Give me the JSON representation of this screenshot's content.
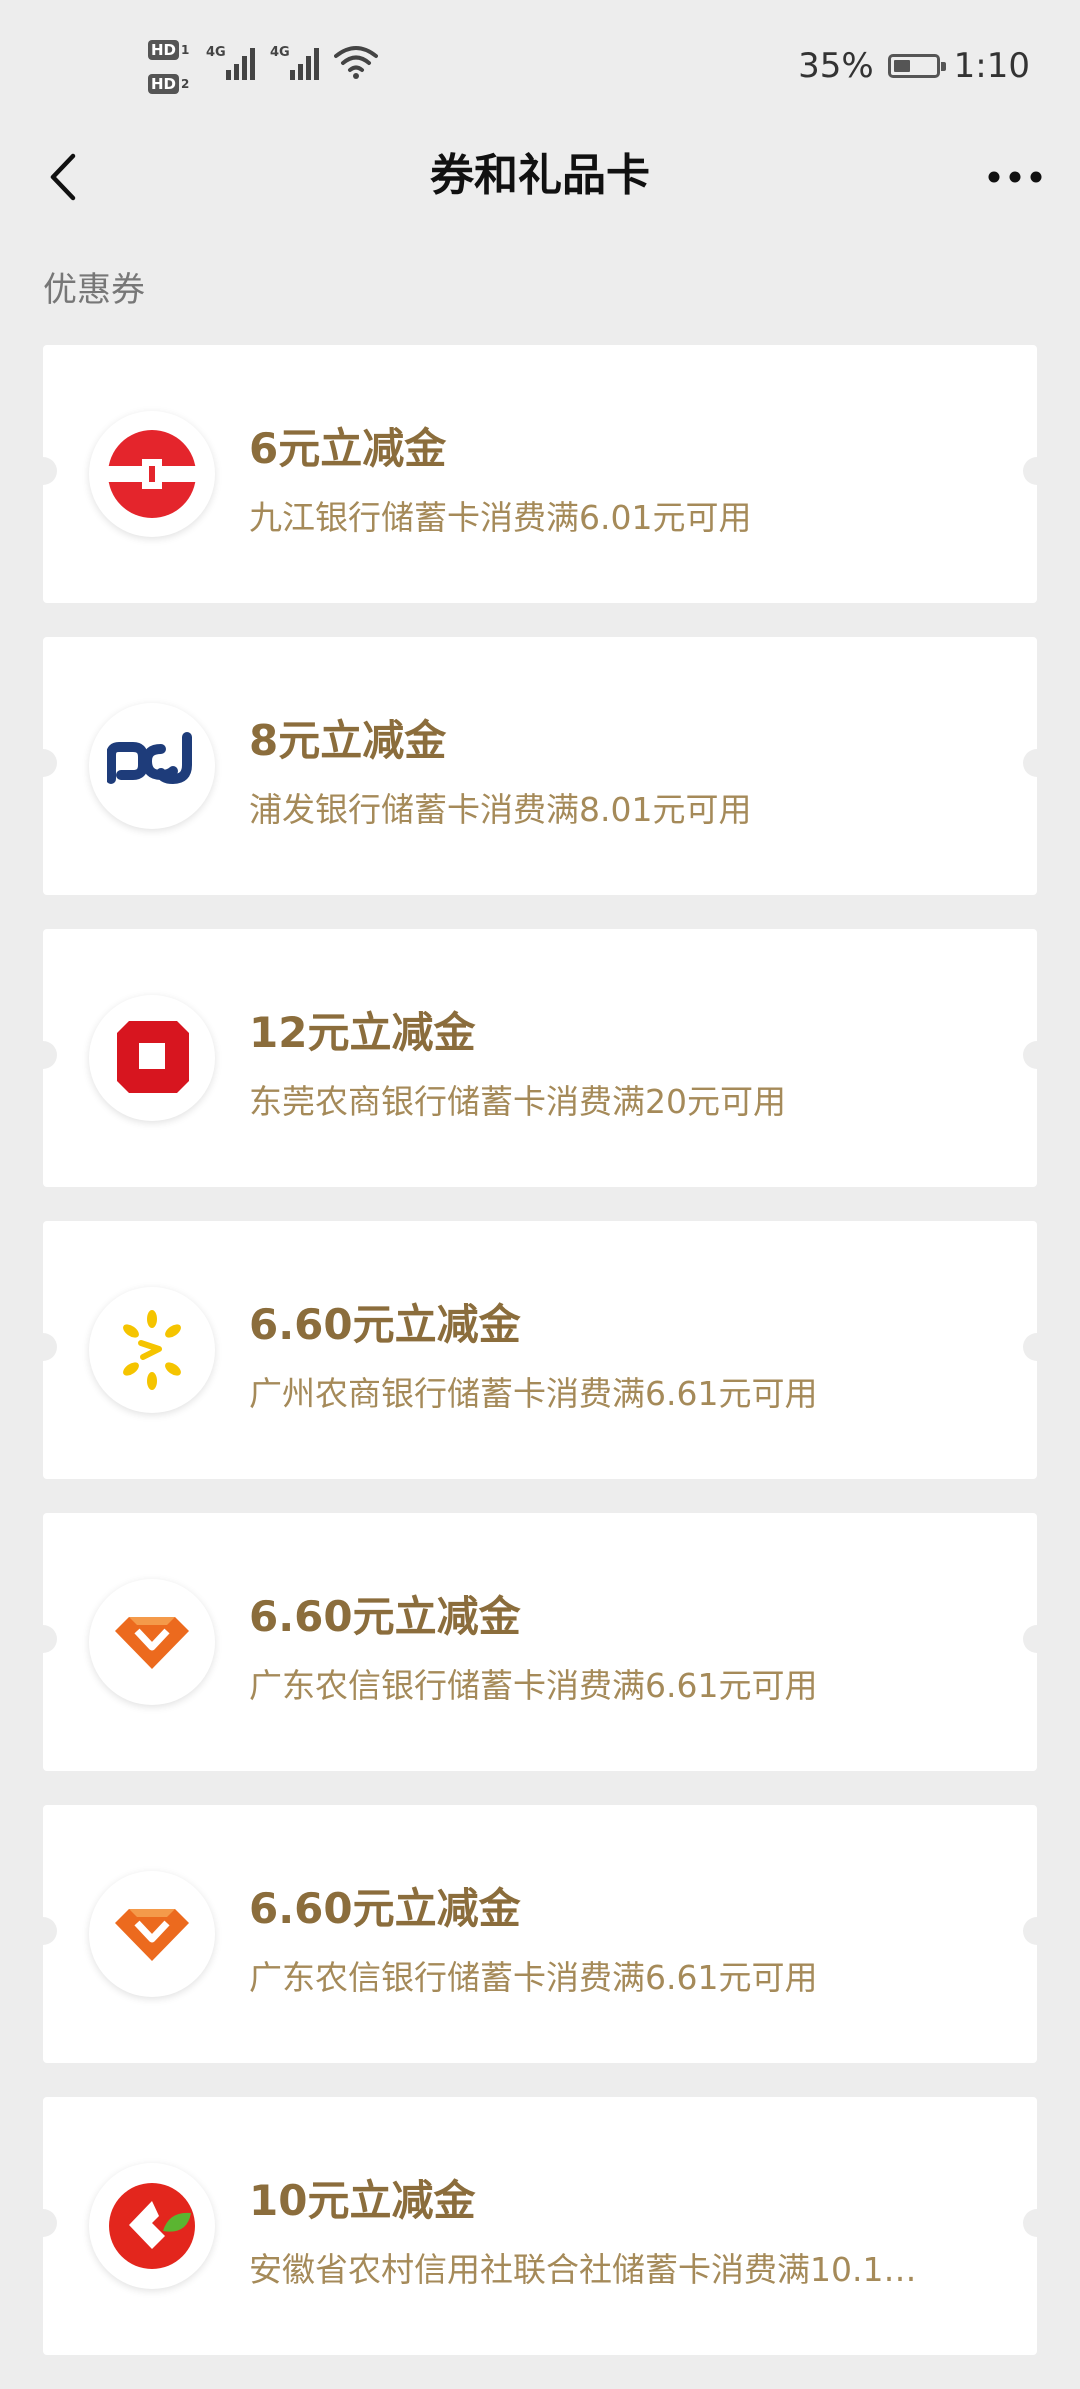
{
  "status_bar": {
    "hd1": "HD",
    "hd1_sub": "1",
    "hd2": "HD",
    "hd2_sub": "2",
    "net1": "4G",
    "net2": "4G",
    "battery_percent": "35%",
    "time": "1:10"
  },
  "nav": {
    "title": "券和礼品卡"
  },
  "section": {
    "label": "优惠券"
  },
  "coupons": [
    {
      "title": "6元立减金",
      "desc": "九江银行储蓄卡消费满6.01元可用",
      "logo": "jiujiang-bank-logo"
    },
    {
      "title": "8元立减金",
      "desc": "浦发银行储蓄卡消费满8.01元可用",
      "logo": "spdb-logo"
    },
    {
      "title": "12元立减金",
      "desc": "东莞农商银行储蓄卡消费满20元可用",
      "logo": "dongguan-rcb-logo"
    },
    {
      "title": "6.60元立减金",
      "desc": "广州农商银行储蓄卡消费满6.61元可用",
      "logo": "guangzhou-rcb-logo"
    },
    {
      "title": "6.60元立减金",
      "desc": "广东农信银行储蓄卡消费满6.61元可用",
      "logo": "guangdong-rcc-logo"
    },
    {
      "title": "6.60元立减金",
      "desc": "广东农信银行储蓄卡消费满6.61元可用",
      "logo": "guangdong-rcc-logo"
    },
    {
      "title": "10元立减金",
      "desc": "安徽省农村信用社联合社储蓄卡消费满10.1…",
      "logo": "anhui-rcc-logo"
    }
  ],
  "colors": {
    "background": "#ededed",
    "coupon_title": "#8b6d3c",
    "coupon_desc": "#a58a59"
  }
}
